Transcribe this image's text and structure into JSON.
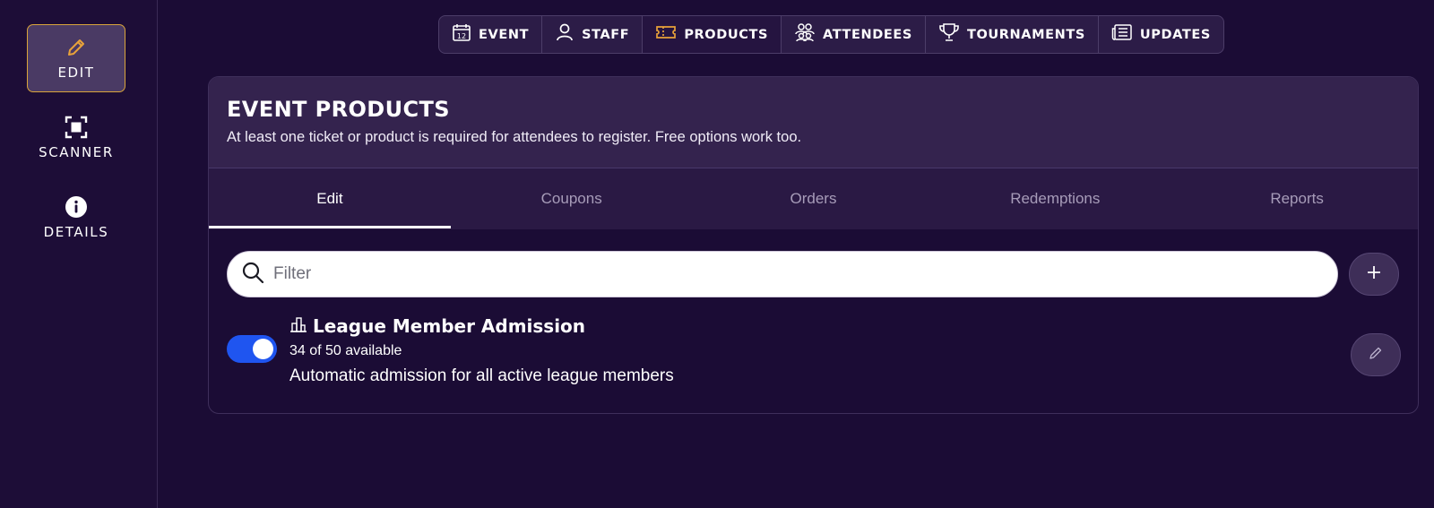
{
  "sidebar": {
    "items": [
      {
        "label": "EDIT",
        "icon": "pencil-icon",
        "active": true
      },
      {
        "label": "SCANNER",
        "icon": "scanner-icon",
        "active": false
      },
      {
        "label": "DETAILS",
        "icon": "info-icon",
        "active": false
      }
    ]
  },
  "topnav": {
    "items": [
      {
        "label": "EVENT",
        "icon": "calendar-icon"
      },
      {
        "label": "STAFF",
        "icon": "person-icon"
      },
      {
        "label": "PRODUCTS",
        "icon": "ticket-icon",
        "active": true
      },
      {
        "label": "ATTENDEES",
        "icon": "people-icon"
      },
      {
        "label": "TOURNAMENTS",
        "icon": "trophy-icon"
      },
      {
        "label": "UPDATES",
        "icon": "newspaper-icon"
      }
    ],
    "calendar_day": "12"
  },
  "card": {
    "title": "EVENT PRODUCTS",
    "description": "At least one ticket or product is required for attendees to register. Free options work too."
  },
  "subtabs": {
    "items": [
      {
        "label": "Edit",
        "active": true
      },
      {
        "label": "Coupons"
      },
      {
        "label": "Orders"
      },
      {
        "label": "Redemptions"
      },
      {
        "label": "Reports"
      }
    ]
  },
  "filter": {
    "placeholder": "Filter",
    "value": ""
  },
  "products": [
    {
      "name": "League Member Admission",
      "availability": "34 of 50 available",
      "description": "Automatic admission for all active league members",
      "enabled": true
    }
  ],
  "colors": {
    "background": "#1b0c35",
    "accent_gold": "#d9a43a",
    "toggle_blue": "#1f55f0",
    "header_purple": "#34234e"
  }
}
